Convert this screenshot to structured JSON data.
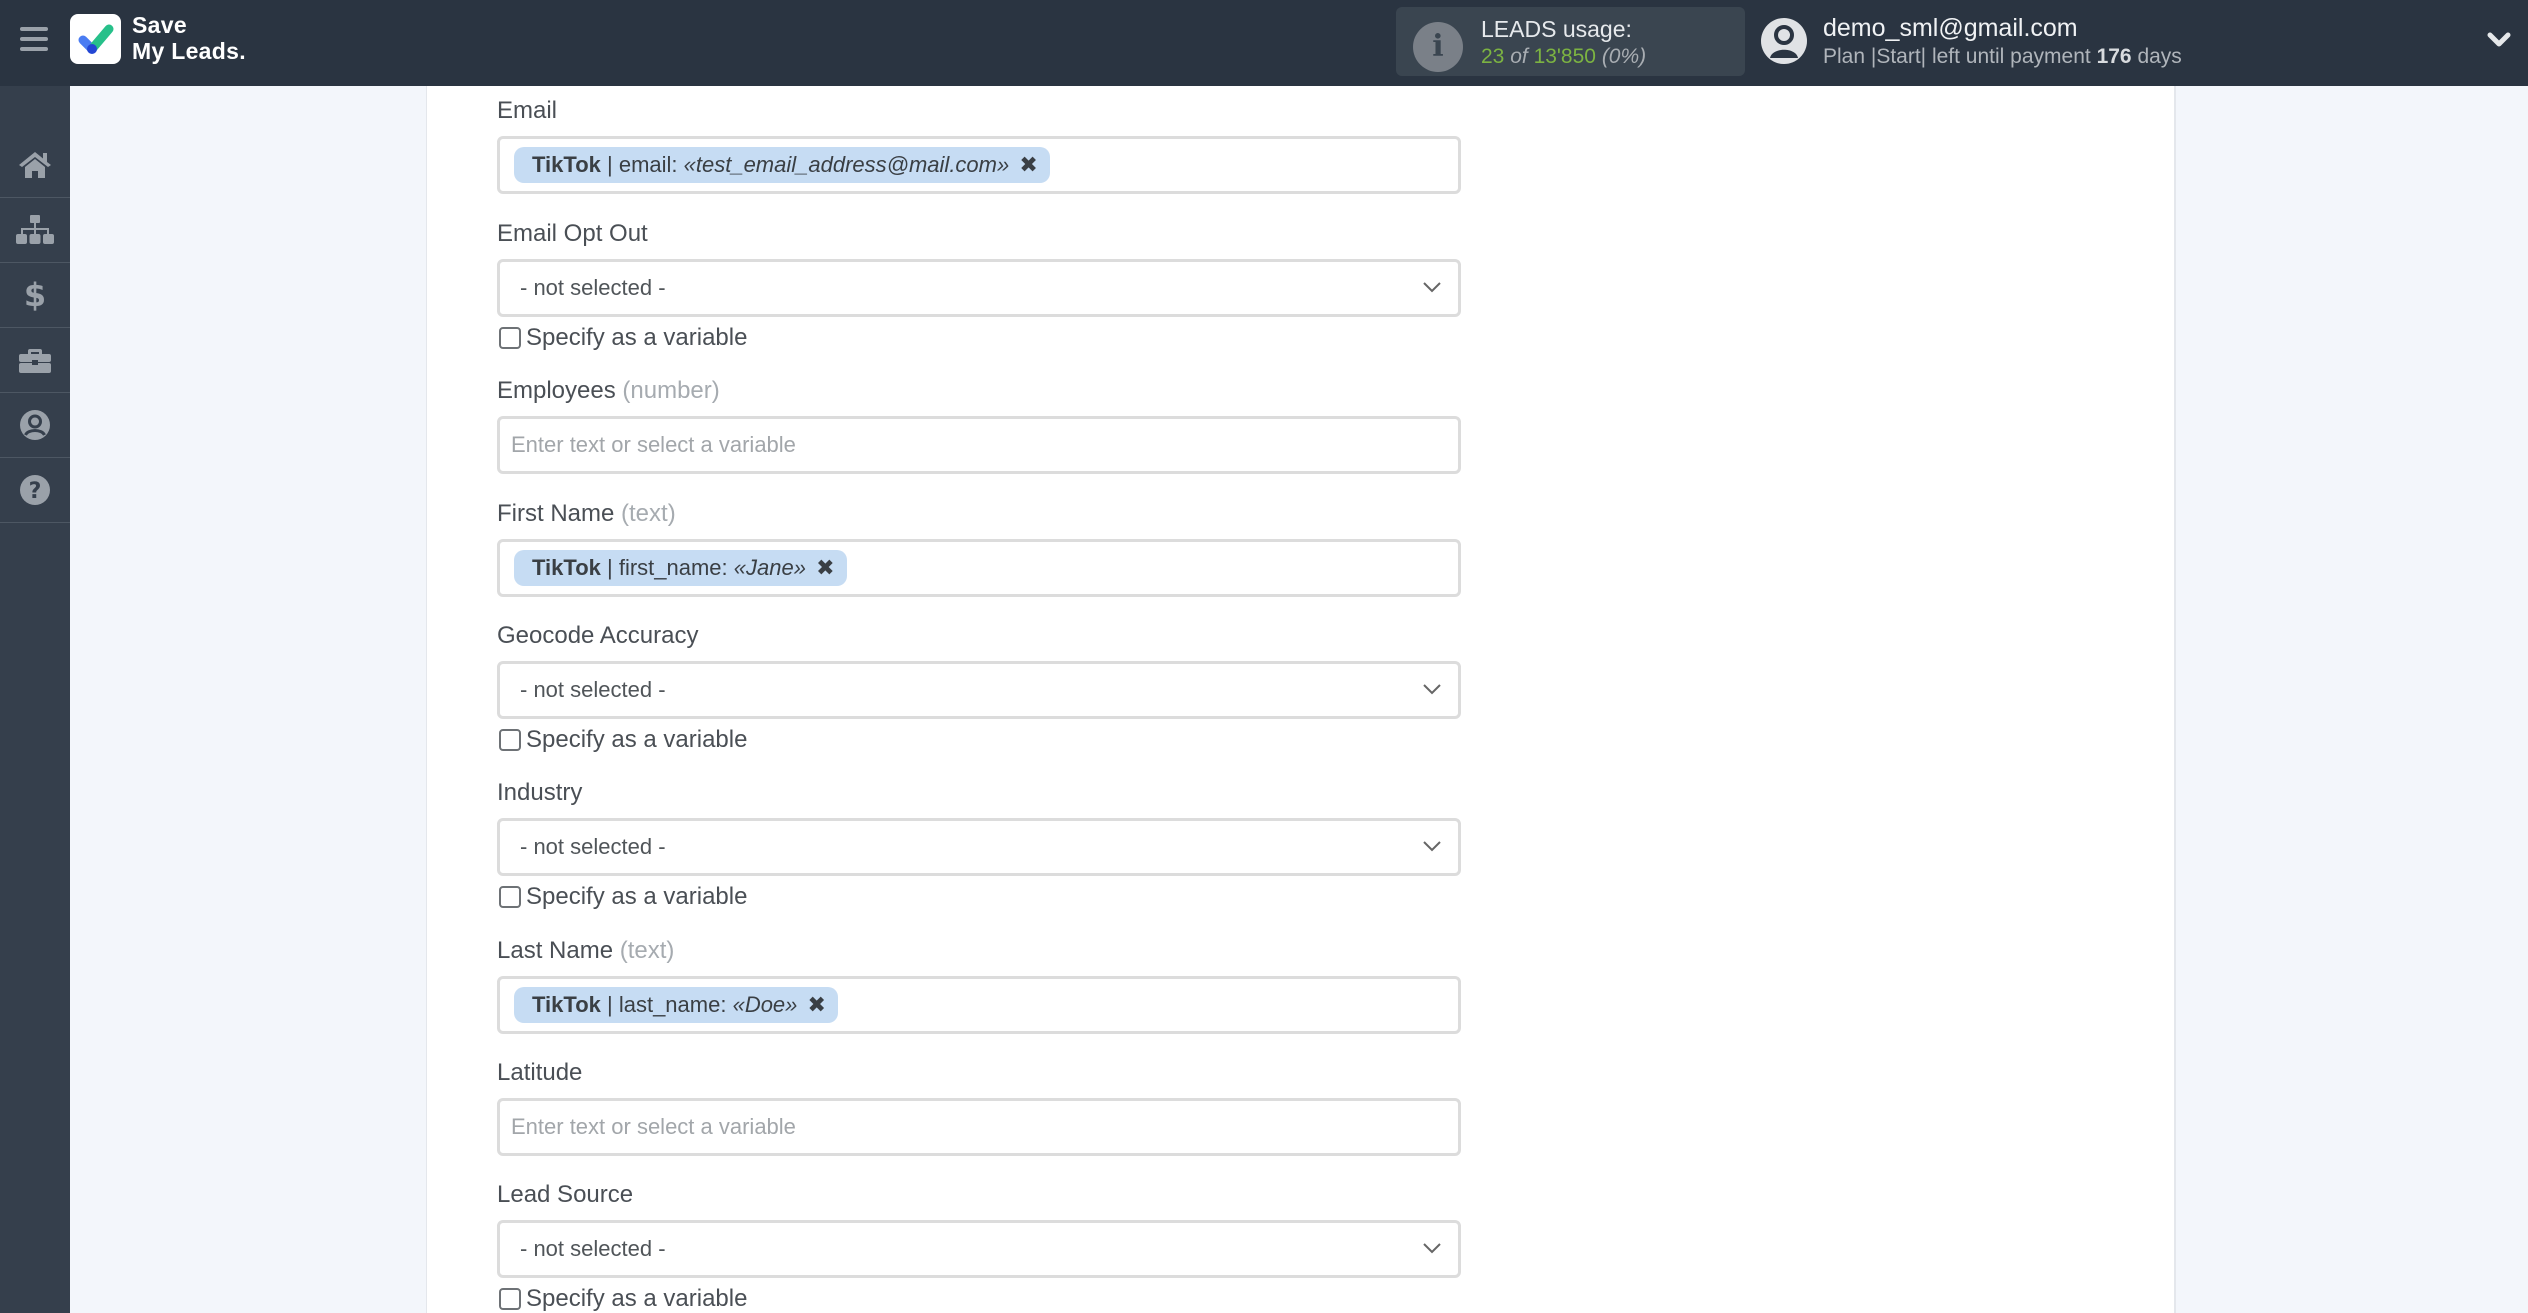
{
  "header": {
    "menu_icon": "hamburger-menu-icon",
    "logo": {
      "icon": "checkmark-logo-icon",
      "line1": "Save",
      "line2": "My Leads."
    },
    "leads_usage": {
      "icon": "info-icon",
      "title": "LEADS usage:",
      "used": "23",
      "of_label": "of",
      "total": "13'850",
      "percent": "(0%)"
    },
    "user": {
      "avatar_icon": "user-circle-icon",
      "email": "demo_sml@gmail.com",
      "plan_prefix": "Plan |Start| left until payment",
      "days": "176",
      "days_suffix": "days",
      "dropdown_icon": "chevron-down-icon"
    }
  },
  "sidebar": {
    "items": [
      {
        "name": "home",
        "icon": "home-icon"
      },
      {
        "name": "connections",
        "icon": "sitemap-icon"
      },
      {
        "name": "billing",
        "icon": "dollar-icon"
      },
      {
        "name": "tools",
        "icon": "briefcase-icon"
      },
      {
        "name": "account",
        "icon": "user-circle-icon"
      },
      {
        "name": "help",
        "icon": "question-circle-icon"
      }
    ]
  },
  "form": {
    "checkbox_label": "Specify as a variable",
    "placeholder": "Enter text or select a variable",
    "not_selected": "- not selected -",
    "fields": [
      {
        "label": "Email",
        "hint": "",
        "type": "tag",
        "tag": {
          "source": "TikTok",
          "field": "| email:",
          "value": "«test_email_address@mail.com»",
          "remove": "✖"
        }
      },
      {
        "label": "Email Opt Out",
        "hint": "",
        "type": "select",
        "value": "- not selected -",
        "specify_variable": false
      },
      {
        "label": "Employees",
        "hint": "(number)",
        "type": "text",
        "value": ""
      },
      {
        "label": "First Name",
        "hint": "(text)",
        "type": "tag",
        "tag": {
          "source": "TikTok",
          "field": "| first_name:",
          "value": "«Jane»",
          "remove": "✖"
        }
      },
      {
        "label": "Geocode Accuracy",
        "hint": "",
        "type": "select",
        "value": "- not selected -",
        "specify_variable": false
      },
      {
        "label": "Industry",
        "hint": "",
        "type": "select",
        "value": "- not selected -",
        "specify_variable": false
      },
      {
        "label": "Last Name",
        "hint": "(text)",
        "type": "tag",
        "tag": {
          "source": "TikTok",
          "field": "| last_name:",
          "value": "«Doe»",
          "remove": "✖"
        }
      },
      {
        "label": "Latitude",
        "hint": "",
        "type": "text",
        "value": ""
      },
      {
        "label": "Lead Source",
        "hint": "",
        "type": "select",
        "value": "- not selected -",
        "specify_variable": false
      }
    ]
  },
  "colors": {
    "header_bg": "#2a3441",
    "sidebar_bg": "#353f4c",
    "usage_green": "#7cb342",
    "tag_bg": "#c6dcf3",
    "page_bg": "#f3f6fb"
  }
}
